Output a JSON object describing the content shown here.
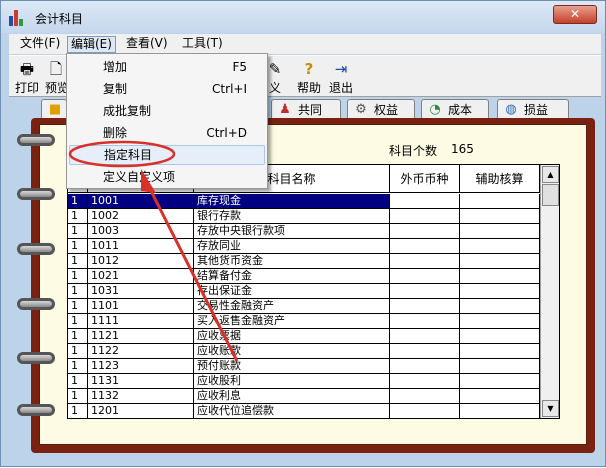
{
  "window": {
    "title": "会计科目",
    "close_symbol": "✕"
  },
  "menubar": {
    "items": [
      "文件(F)",
      "编辑(E)",
      "查看(V)",
      "工具(T)"
    ]
  },
  "toolbar": {
    "print": "打印",
    "preview": "预览",
    "define": "义",
    "help": "帮助",
    "exit": "退出"
  },
  "tabs": {
    "common": "共同",
    "equity": "权益",
    "cost": "成本",
    "pnl": "损益"
  },
  "summary": {
    "count_label": "科目个数",
    "count_value": "165"
  },
  "grid": {
    "headers": {
      "name": "科目名称",
      "currency": "外币币种",
      "aux": "辅助核算"
    },
    "rows": [
      {
        "level": "1",
        "code": "1001",
        "name": "库存现金"
      },
      {
        "level": "1",
        "code": "1002",
        "name": "银行存款"
      },
      {
        "level": "1",
        "code": "1003",
        "name": "存放中央银行款项"
      },
      {
        "level": "1",
        "code": "1011",
        "name": "存放同业"
      },
      {
        "level": "1",
        "code": "1012",
        "name": "其他货币资金"
      },
      {
        "level": "1",
        "code": "1021",
        "name": "结算备付金"
      },
      {
        "level": "1",
        "code": "1031",
        "name": "存出保证金"
      },
      {
        "level": "1",
        "code": "1101",
        "name": "交易性金融资产"
      },
      {
        "level": "1",
        "code": "1111",
        "name": "买入返售金融资产"
      },
      {
        "level": "1",
        "code": "1121",
        "name": "应收票据"
      },
      {
        "level": "1",
        "code": "1122",
        "name": "应收账款"
      },
      {
        "level": "1",
        "code": "1123",
        "name": "预付账款"
      },
      {
        "level": "1",
        "code": "1131",
        "name": "应收股利"
      },
      {
        "level": "1",
        "code": "1132",
        "name": "应收利息"
      },
      {
        "level": "1",
        "code": "1201",
        "name": "应收代位追偿款"
      }
    ]
  },
  "edit_menu": {
    "add": "增加",
    "add_shortcut": "F5",
    "copy": "复制",
    "copy_shortcut": "Ctrl+I",
    "batch_copy": "成批复制",
    "delete": "删除",
    "delete_shortcut": "Ctrl+D",
    "assign": "指定科目",
    "custom": "定义自定义项"
  },
  "colors": {
    "accent_red": "#d9302a",
    "selection": "#000080",
    "binder": "#7a2212"
  }
}
